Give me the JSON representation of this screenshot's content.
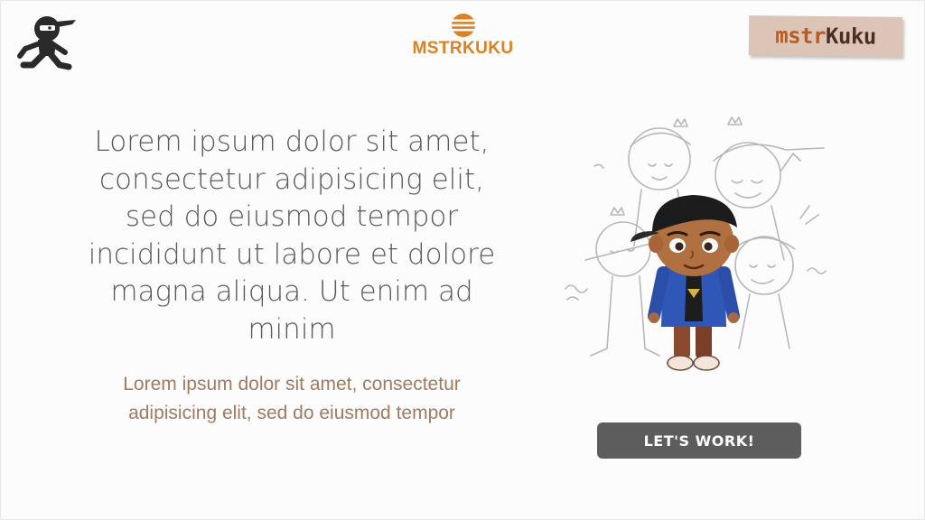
{
  "header": {
    "brand_name": "MSTRKUKU",
    "sticker_part_1": "mstr",
    "sticker_part_2": "Kuku",
    "left_logo_icon": "ninja-runner-icon",
    "brand_icon": "striped-circle-icon"
  },
  "hero": {
    "headline": "Lorem ipsum dolor sit amet, consectetur adipisicing elit, sed do eiusmod tempor incididunt ut labore et dolore magna aliqua. Ut enim ad minim",
    "subtext": "Lorem ipsum dolor sit amet, consectetur adipisicing elit, sed do eiusmod tempor",
    "cta_label": "LET'S WORK!"
  },
  "colors": {
    "brand_orange": "#e07f20",
    "subtext_brown": "#a17a5f",
    "headline_gray": "#5a5a5a",
    "button_gray": "#5d5d5d",
    "sticker_bg": "#dcc4b6"
  }
}
